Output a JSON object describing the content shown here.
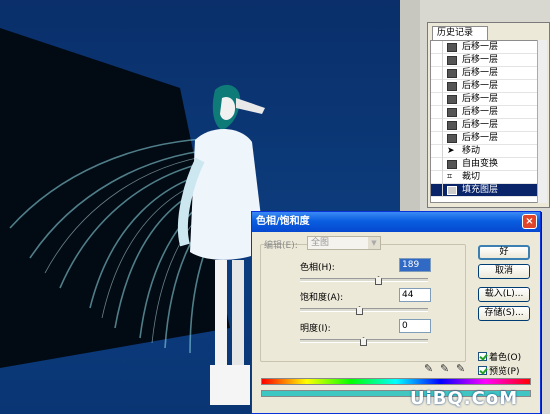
{
  "history": {
    "tab": "历史记录",
    "items": [
      {
        "label": "后移一层",
        "icon": "layer-icon"
      },
      {
        "label": "后移一层",
        "icon": "layer-icon"
      },
      {
        "label": "后移一层",
        "icon": "layer-icon"
      },
      {
        "label": "后移一层",
        "icon": "layer-icon"
      },
      {
        "label": "后移一层",
        "icon": "layer-icon"
      },
      {
        "label": "后移一层",
        "icon": "layer-icon"
      },
      {
        "label": "后移一层",
        "icon": "layer-icon"
      },
      {
        "label": "后移一层",
        "icon": "layer-icon"
      },
      {
        "label": "移动",
        "icon": "move-icon"
      },
      {
        "label": "自由变换",
        "icon": "layer-icon"
      },
      {
        "label": "裁切",
        "icon": "crop-icon"
      },
      {
        "label": "填充图层",
        "icon": "layer-icon",
        "selected": true
      }
    ]
  },
  "dialog": {
    "title": "色相/饱和度",
    "close": "×",
    "edit_label": "编辑(E):",
    "edit_value": "全图",
    "hue_label": "色相(H):",
    "hue_value": "189",
    "saturation_label": "饱和度(A):",
    "saturation_value": "44",
    "lightness_label": "明度(I):",
    "lightness_value": "0",
    "ok": "好",
    "cancel": "取消",
    "load": "载入(L)...",
    "save": "存储(S)...",
    "colorize_label": "着色(O)",
    "preview_label": "预览(P)"
  },
  "watermark": "UiBQ.CoM",
  "colors": {
    "canvas_bg": "#0b3a78",
    "selection": "#0a246a",
    "titlebar": "#0a5ee0"
  }
}
